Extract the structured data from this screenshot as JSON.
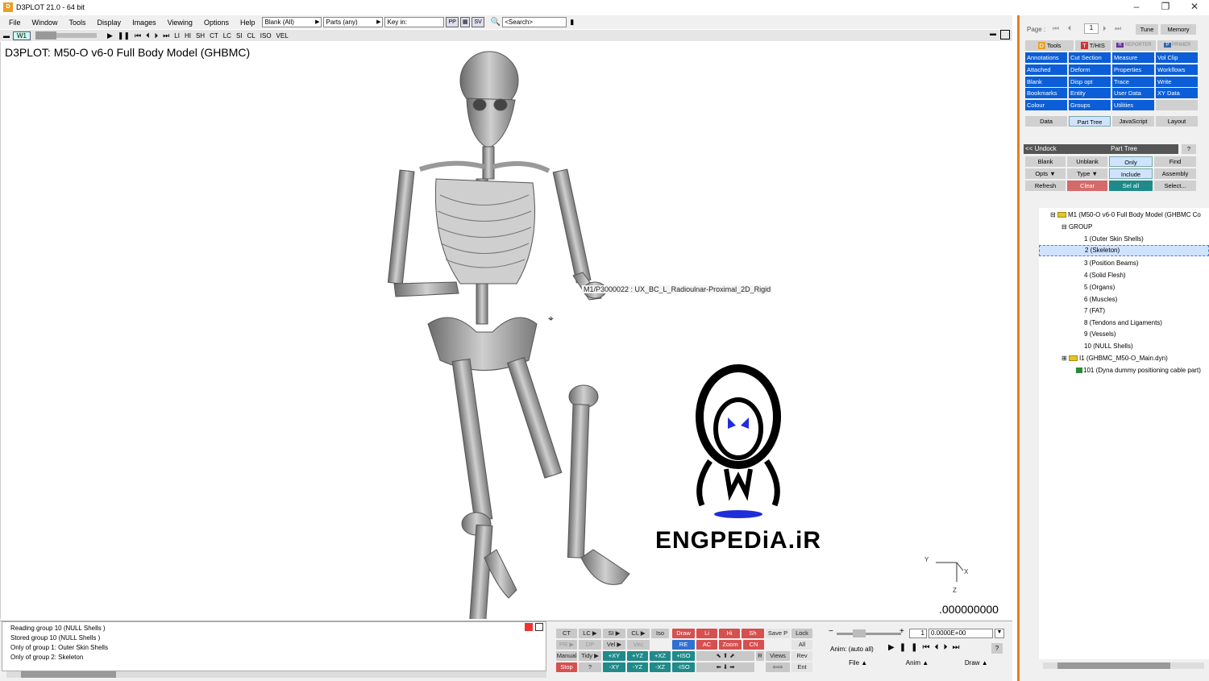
{
  "window": {
    "title": "D3PLOT 21.0 - 64 bit"
  },
  "menu": {
    "items": [
      "File",
      "Window",
      "Tools",
      "Display",
      "Images",
      "Viewing",
      "Options",
      "Help"
    ],
    "blank_dd": "Blank (All)",
    "parts_dd": "Parts (any)",
    "key_in": "Key in:",
    "pp": "PP",
    "sv": "SV",
    "search_placeholder": "<Search>"
  },
  "animbar": {
    "window_label": "W1",
    "labels": [
      "LI",
      "HI",
      "SH",
      "CT",
      "LC",
      "SI",
      "CL",
      "ISO",
      "VEL"
    ]
  },
  "viewport": {
    "title": "D3PLOT: M50-O v6-0 Full Body Model (GHBMC)",
    "hover_label": "M1/P3000022 : UX_BC_L_Radioulnar-Proximal_2D_Rigid",
    "time": ".000000000",
    "axes": {
      "y": "Y",
      "x": "X",
      "z": "Z"
    },
    "watermark": "ENGPEDiA.iR"
  },
  "messages": [
    "Reading group 10 (NULL Shells )",
    "Stored group 10 (NULL Shells )",
    "Only of group 1: Outer Skin Shells",
    "Only of group 2: Skeleton"
  ],
  "controls": {
    "row1": [
      "CT",
      "LC ▶",
      "SI ▶",
      "CL ▶",
      "Iso",
      "Draw",
      "Li",
      "Hi",
      "Sh",
      "Save P",
      "Lock"
    ],
    "row2": [
      "PR ▶",
      "DP",
      "Vel ▶",
      "Vec",
      "RE",
      "AC",
      "Zoom",
      "CN",
      "All"
    ],
    "row3": [
      "Manual",
      "Tidy ▶",
      "+XY",
      "+YZ",
      "+XZ",
      "+ISO",
      "R",
      "Views",
      "Rev"
    ],
    "row4": [
      "Stop",
      "?",
      "-XY",
      "-YZ",
      "-XZ",
      "-ISO",
      "Ent"
    ],
    "state_value": "1",
    "time_value": "0.0000E+00",
    "anim_label": "Anim: (auto all)",
    "bottom_tabs": [
      "File",
      "Anim",
      "Draw"
    ]
  },
  "right_panel": {
    "page_label": "Page :",
    "page_value": "1",
    "tune": "Tune",
    "memory": "Memory",
    "tools": "Tools",
    "this": "T/HIS",
    "reporter": "REPORTER",
    "primer": "PRIMER",
    "grid": [
      [
        "Annotations",
        "Cut Section",
        "Measure",
        "Vol Clip"
      ],
      [
        "Attached",
        "Deform",
        "Properties",
        "Workflows"
      ],
      [
        "Blank",
        "Disp opt",
        "Trace",
        "Write"
      ],
      [
        "Bookmarks",
        "Entity",
        "User Data",
        "XY Data"
      ],
      [
        "Colour",
        "Groups",
        "Utilities",
        ""
      ]
    ],
    "tabs": [
      "Data",
      "Part Tree",
      "JavaScript",
      "Layout"
    ],
    "undock": "<< Undock",
    "part_tree_title": "Part Tree",
    "help": "?",
    "ops_row1": [
      "Blank",
      "Unblank",
      "Only",
      "Find"
    ],
    "ops_row2": [
      "Opts",
      "Type",
      "Include",
      "Assembly"
    ],
    "ops_row3": [
      "Refresh",
      "Clear",
      "Sel all",
      "Select..."
    ],
    "tree": {
      "model": "M1 (M50-O v6-0 Full Body Model (GHBMC Co",
      "group": "GROUP",
      "items": [
        "1 (Outer Skin Shells)",
        "2 (Skeleton)",
        "3 (Position Beams)",
        "4 (Solid Flesh)",
        "5 (Organs)",
        "6 (Muscles)",
        "7 (FAT)",
        "8 (Tendons and Ligaments)",
        "9 (Vessels)",
        "10 (NULL Shells)"
      ],
      "include": "I1 (GHBMC_M50-O_Main.dyn)",
      "part": "101 (Dyna dummy positioning cable part)"
    }
  }
}
